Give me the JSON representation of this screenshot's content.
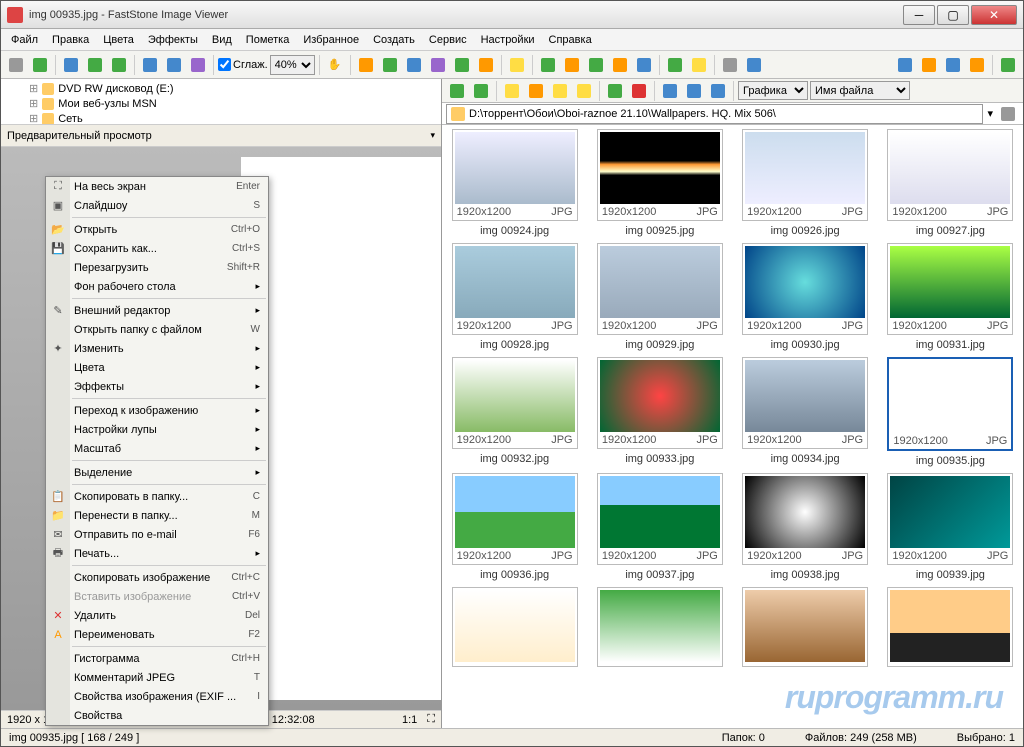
{
  "title": "img 00935.jpg  -  FastStone Image Viewer",
  "menu": [
    "Файл",
    "Правка",
    "Цвета",
    "Эффекты",
    "Вид",
    "Пометка",
    "Избранное",
    "Создать",
    "Сервис",
    "Настройки",
    "Справка"
  ],
  "toolbar": {
    "smooth_label": "Сглаж.",
    "zoom": "40%"
  },
  "tree": {
    "items": [
      "DVD RW дисковод (E:)",
      "Мои веб-узлы MSN",
      "Сеть"
    ]
  },
  "preview": {
    "header": "Предварительный просмотр",
    "info": "1920 x 1200 (2.30 MP)  24bit  JPG  190 KB  2013-10-28 12:32:08",
    "ratio": "1:1"
  },
  "right": {
    "filter": "Графика",
    "sort": "Имя файла",
    "path": "D:\\торрент\\Обои\\Oboi-raznoe 21.10\\Wallpapers. HQ. Mix 506\\"
  },
  "thumbnails": [
    {
      "name": "img 00924.jpg",
      "res": "1920x1200",
      "type": "JPG",
      "cls": "t0"
    },
    {
      "name": "img 00925.jpg",
      "res": "1920x1200",
      "type": "JPG",
      "cls": "t1"
    },
    {
      "name": "img 00926.jpg",
      "res": "1920x1200",
      "type": "JPG",
      "cls": "t2"
    },
    {
      "name": "img 00927.jpg",
      "res": "1920x1200",
      "type": "JPG",
      "cls": "t3"
    },
    {
      "name": "img 00928.jpg",
      "res": "1920x1200",
      "type": "JPG",
      "cls": "t4"
    },
    {
      "name": "img 00929.jpg",
      "res": "1920x1200",
      "type": "JPG",
      "cls": "t5"
    },
    {
      "name": "img 00930.jpg",
      "res": "1920x1200",
      "type": "JPG",
      "cls": "t6"
    },
    {
      "name": "img 00931.jpg",
      "res": "1920x1200",
      "type": "JPG",
      "cls": "t7"
    },
    {
      "name": "img 00932.jpg",
      "res": "1920x1200",
      "type": "JPG",
      "cls": "t8"
    },
    {
      "name": "img 00933.jpg",
      "res": "1920x1200",
      "type": "JPG",
      "cls": "t9"
    },
    {
      "name": "img 00934.jpg",
      "res": "1920x1200",
      "type": "JPG",
      "cls": "t10"
    },
    {
      "name": "img 00935.jpg",
      "res": "1920x1200",
      "type": "JPG",
      "cls": "t11",
      "selected": true
    },
    {
      "name": "img 00936.jpg",
      "res": "1920x1200",
      "type": "JPG",
      "cls": "t12"
    },
    {
      "name": "img 00937.jpg",
      "res": "1920x1200",
      "type": "JPG",
      "cls": "t13"
    },
    {
      "name": "img 00938.jpg",
      "res": "1920x1200",
      "type": "JPG",
      "cls": "t14"
    },
    {
      "name": "img 00939.jpg",
      "res": "1920x1200",
      "type": "JPG",
      "cls": "t15"
    },
    {
      "name": "",
      "res": "",
      "type": "",
      "cls": "t16"
    },
    {
      "name": "",
      "res": "",
      "type": "",
      "cls": "t17"
    },
    {
      "name": "",
      "res": "",
      "type": "",
      "cls": "t18"
    },
    {
      "name": "",
      "res": "",
      "type": "",
      "cls": "t19"
    }
  ],
  "context": [
    {
      "icon": "⛶",
      "label": "На весь экран",
      "shortcut": "Enter"
    },
    {
      "icon": "▣",
      "label": "Слайдшоу",
      "shortcut": "S"
    },
    {
      "sep": true
    },
    {
      "icon": "📂",
      "label": "Открыть",
      "shortcut": "Ctrl+O"
    },
    {
      "icon": "💾",
      "label": "Сохранить как...",
      "shortcut": "Ctrl+S"
    },
    {
      "label": "Перезагрузить",
      "shortcut": "Shift+R"
    },
    {
      "label": "Фон рабочего стола",
      "sub": true
    },
    {
      "sep": true
    },
    {
      "icon": "✎",
      "label": "Внешний редактор",
      "sub": true
    },
    {
      "label": "Открыть папку с файлом",
      "shortcut": "W"
    },
    {
      "icon": "✦",
      "label": "Изменить",
      "sub": true
    },
    {
      "label": "Цвета",
      "sub": true
    },
    {
      "label": "Эффекты",
      "sub": true
    },
    {
      "sep": true
    },
    {
      "label": "Переход к изображению",
      "sub": true
    },
    {
      "label": "Настройки лупы",
      "sub": true
    },
    {
      "label": "Масштаб",
      "sub": true
    },
    {
      "sep": true
    },
    {
      "label": "Выделение",
      "sub": true
    },
    {
      "sep": true
    },
    {
      "icon": "📋",
      "label": "Скопировать в папку...",
      "shortcut": "C"
    },
    {
      "icon": "📁",
      "label": "Перенести в папку...",
      "shortcut": "M"
    },
    {
      "icon": "✉",
      "label": "Отправить по e-mail",
      "shortcut": "F6"
    },
    {
      "icon": "🖶",
      "label": "Печать...",
      "sub": true
    },
    {
      "sep": true
    },
    {
      "label": "Скопировать изображение",
      "shortcut": "Ctrl+C"
    },
    {
      "label": "Вставить изображение",
      "shortcut": "Ctrl+V",
      "disabled": true
    },
    {
      "icon": "✕",
      "iconColor": "#d33",
      "label": "Удалить",
      "shortcut": "Del"
    },
    {
      "icon": "A",
      "iconColor": "#f90",
      "label": "Переименовать",
      "shortcut": "F2"
    },
    {
      "sep": true
    },
    {
      "label": "Гистограмма",
      "shortcut": "Ctrl+H"
    },
    {
      "label": "Комментарий JPEG",
      "shortcut": "T"
    },
    {
      "label": "Свойства изображения (EXIF ...",
      "shortcut": "I"
    },
    {
      "label": "Свойства"
    }
  ],
  "status": {
    "file": "img 00935.jpg  [ 168 / 249 ]",
    "folders_label": "Папок:",
    "folders": "0",
    "files_label": "Файлов:",
    "files": "249 (258 MB)",
    "selected_label": "Выбрано:",
    "selected": "1"
  },
  "watermark": "ruprogramm.ru"
}
